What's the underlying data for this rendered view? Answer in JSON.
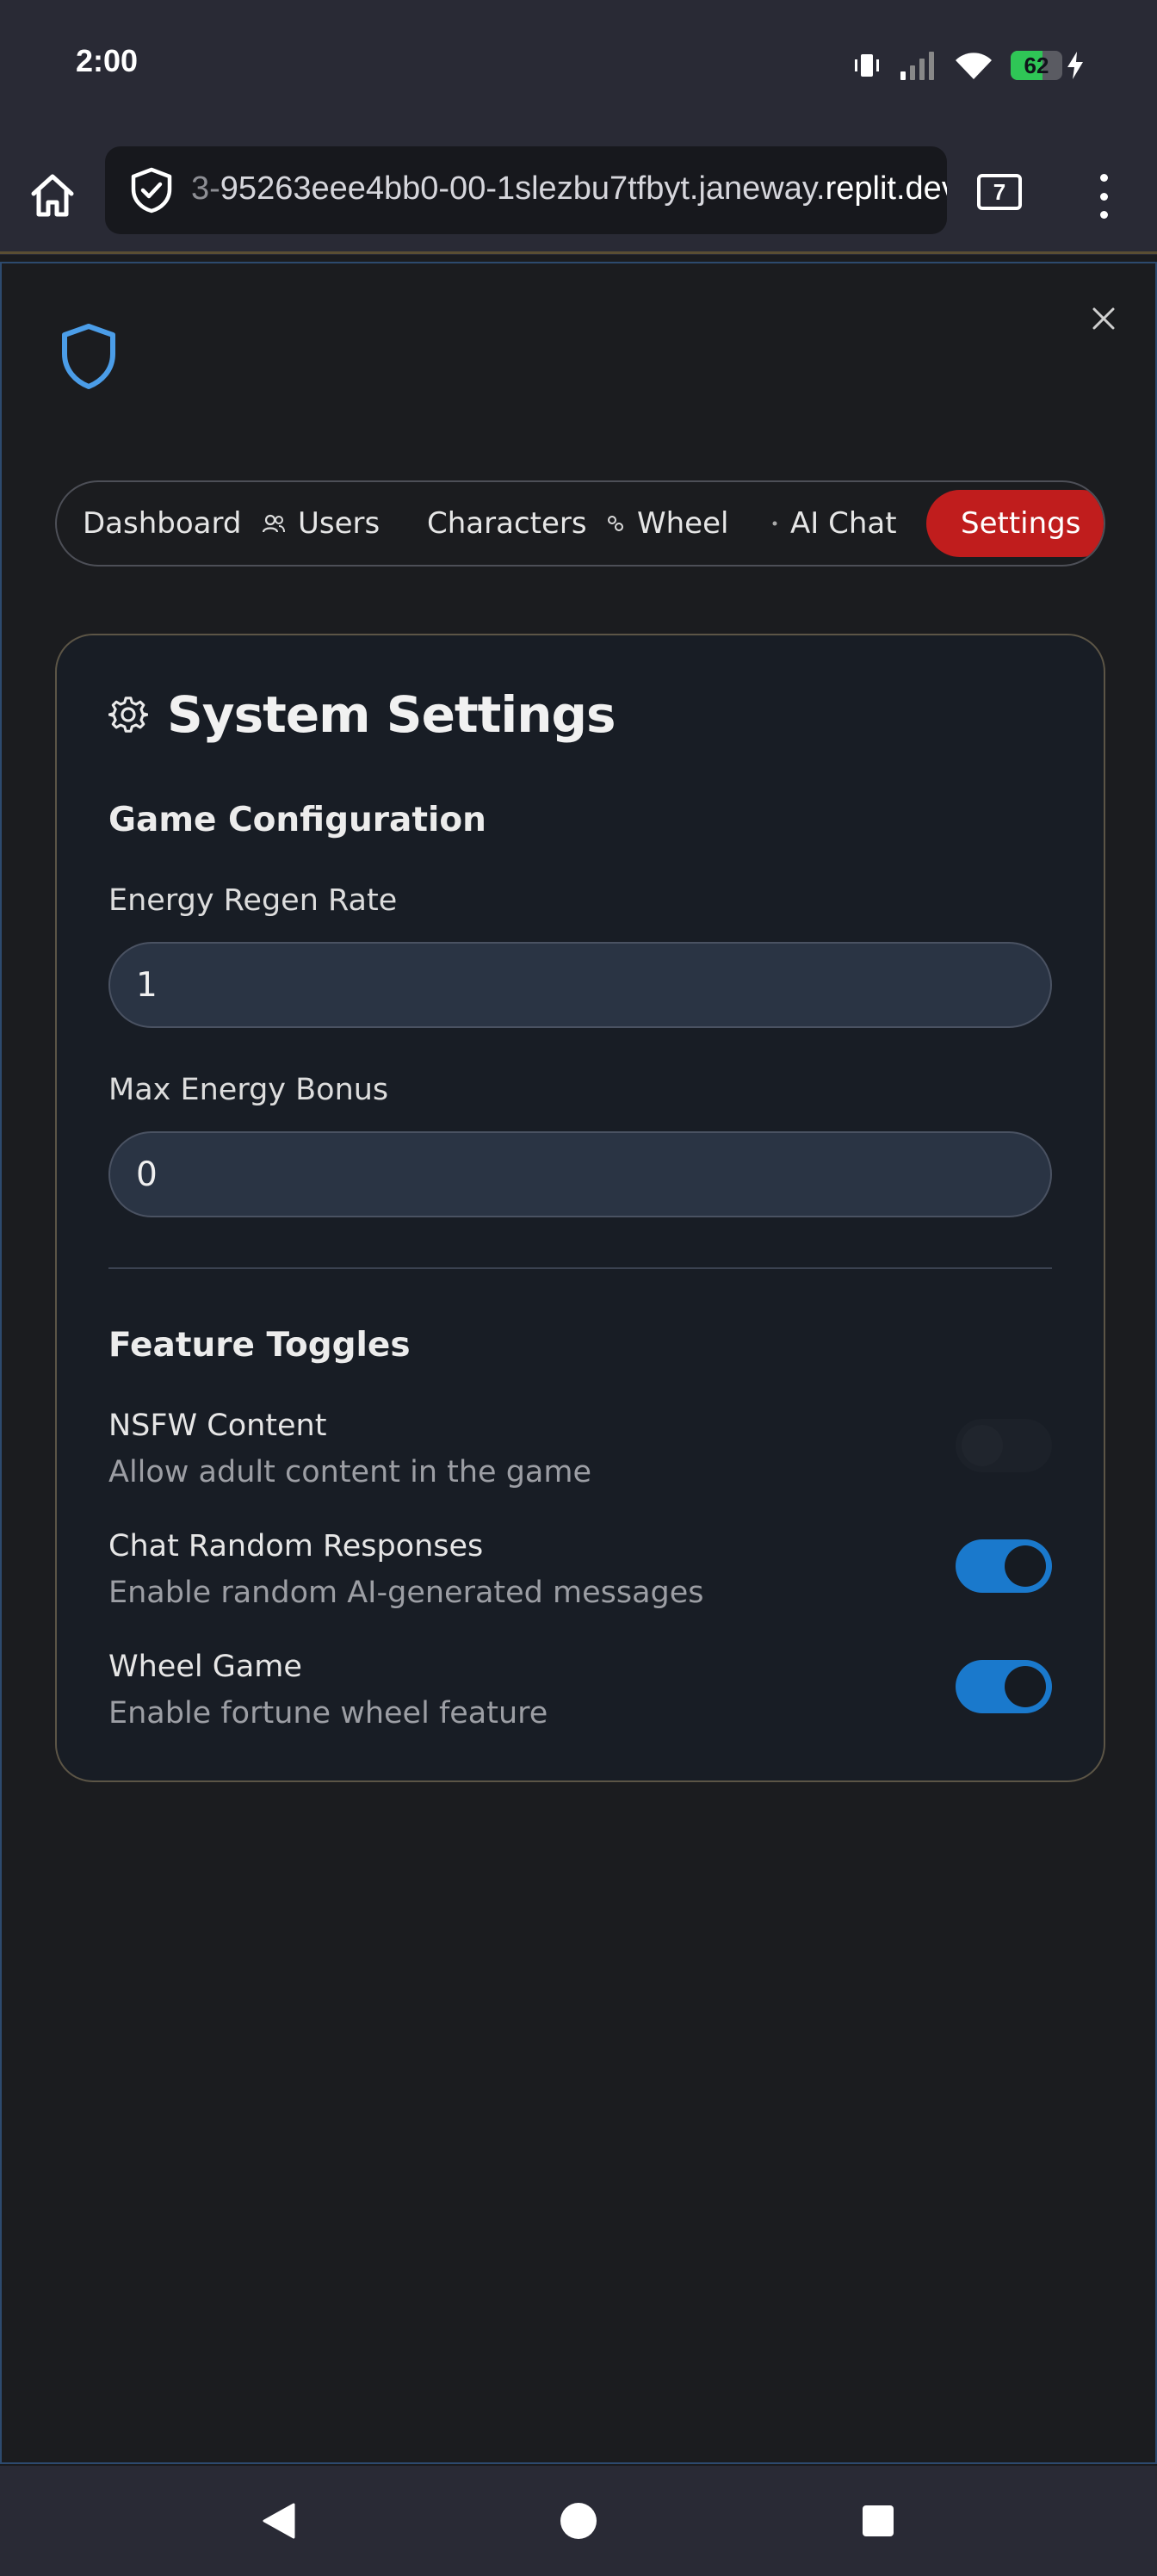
{
  "status_bar": {
    "time": "2:00",
    "battery_percent": 62,
    "battery_label": "62",
    "icons": [
      "vibrate-icon",
      "signal-icon",
      "wifi-icon",
      "battery-icon",
      "charging-bolt-icon"
    ]
  },
  "browser": {
    "url_prefix": "3-",
    "url_main": "95263eee4bb0-00-1slezbu7tfbyt.janeway.",
    "url_domain": "replit.dev",
    "tab_count": "7"
  },
  "app": {
    "close_label": "×",
    "nav": [
      {
        "label": "Dashboard",
        "icon": "none",
        "active": false
      },
      {
        "label": "Users",
        "icon": "users-icon",
        "active": false
      },
      {
        "label": "Characters",
        "icon": "none",
        "active": false
      },
      {
        "label": "Wheel",
        "icon": "wheel-icon",
        "active": false
      },
      {
        "label": "AI Chat",
        "icon": "chat-dot-icon",
        "active": false
      },
      {
        "label": "Settings",
        "icon": "none",
        "active": true
      }
    ],
    "settings": {
      "title": "System Settings",
      "game_config_title": "Game Configuration",
      "energy_regen_label": "Energy Regen Rate",
      "energy_regen_value": "1",
      "max_energy_label": "Max Energy Bonus",
      "max_energy_value": "0",
      "feature_toggles_title": "Feature Toggles",
      "toggles": [
        {
          "name": "NSFW Content",
          "description": "Allow adult content in the game",
          "enabled": false
        },
        {
          "name": "Chat Random Responses",
          "description": "Enable random AI-generated messages",
          "enabled": true
        },
        {
          "name": "Wheel Game",
          "description": "Enable fortune wheel feature",
          "enabled": true
        }
      ]
    }
  },
  "colors": {
    "accent_blue": "#1a79cc",
    "active_tab_red": "#c01d1d",
    "logo_blue": "#4b9de8"
  }
}
